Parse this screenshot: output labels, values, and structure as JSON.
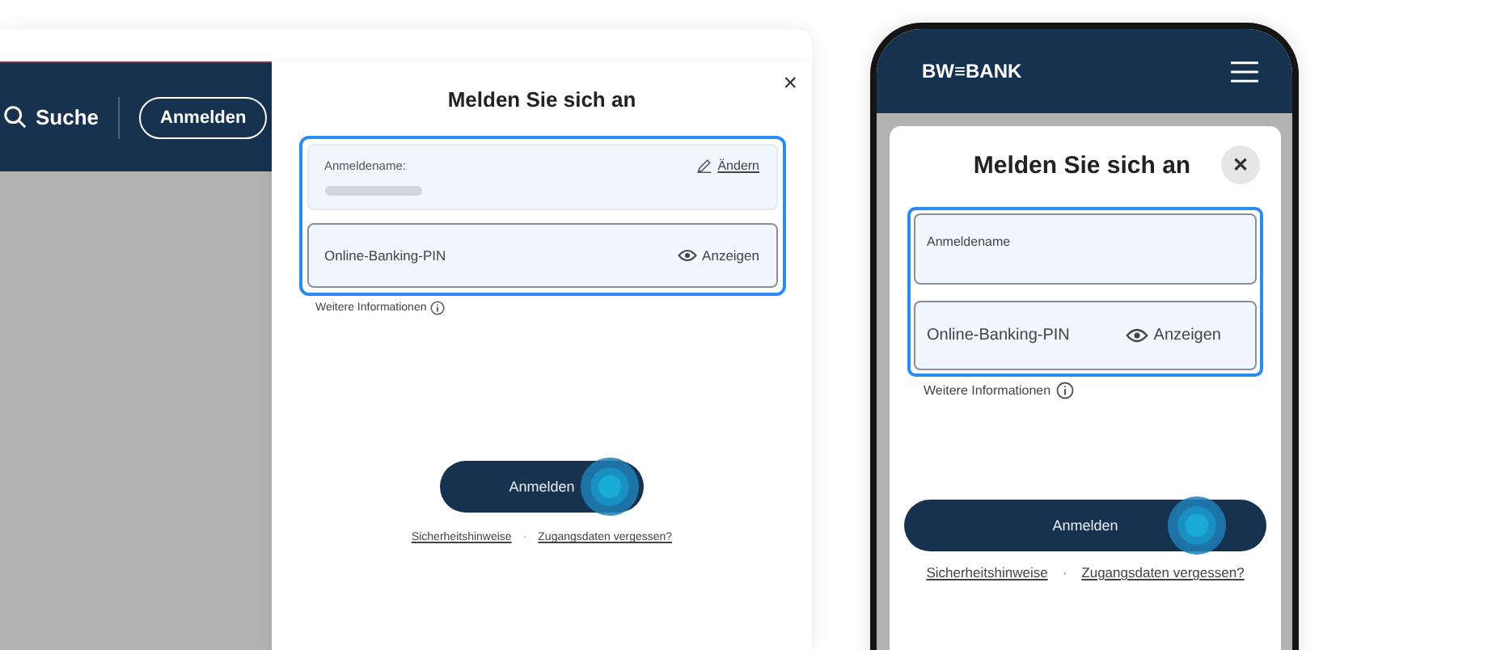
{
  "desktop": {
    "search": "Suche",
    "header_login": "Anmelden",
    "dialog": {
      "title": "Melden Sie sich an",
      "close": "×",
      "username": {
        "label": "Anmeldename:",
        "edit": "Ändern"
      },
      "pin": {
        "placeholder": "Online-Banking-PIN",
        "reveal": "Anzeigen"
      },
      "info": "Weitere Informationen",
      "submit": "Anmelden",
      "links": [
        "Sicherheitshinweise",
        "Zugangsdaten vergessen?"
      ],
      "separator": "·"
    }
  },
  "mobile": {
    "logo": "BW≡BANK",
    "dialog": {
      "title": "Melden Sie sich an",
      "close": "✕",
      "username": {
        "label": "Anmeldename"
      },
      "pin": {
        "placeholder": "Online-Banking-PIN",
        "reveal": "Anzeigen"
      },
      "info": "Weitere Informationen",
      "submit": "Anmelden",
      "links": [
        "Sicherheitshinweise",
        "Zugangsdaten vergessen?"
      ],
      "separator": "·"
    }
  }
}
